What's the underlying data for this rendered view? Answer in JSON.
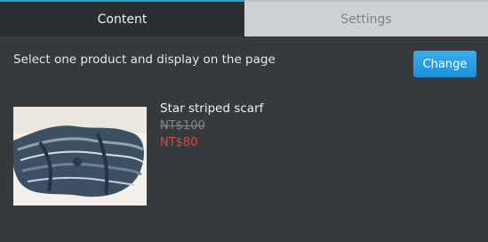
{
  "tabs": [
    {
      "label": "Content",
      "active": true
    },
    {
      "label": "Settings",
      "active": false
    }
  ],
  "main": {
    "instruction": "Select one product and display on the page",
    "change_label": "Change"
  },
  "product": {
    "name": "Star striped scarf",
    "original_price": "NT$100",
    "sale_price": "NT$80"
  },
  "colors": {
    "accent": "#2aa3e0",
    "sale_price": "#e0443e",
    "panel_background": "#353a3e"
  }
}
